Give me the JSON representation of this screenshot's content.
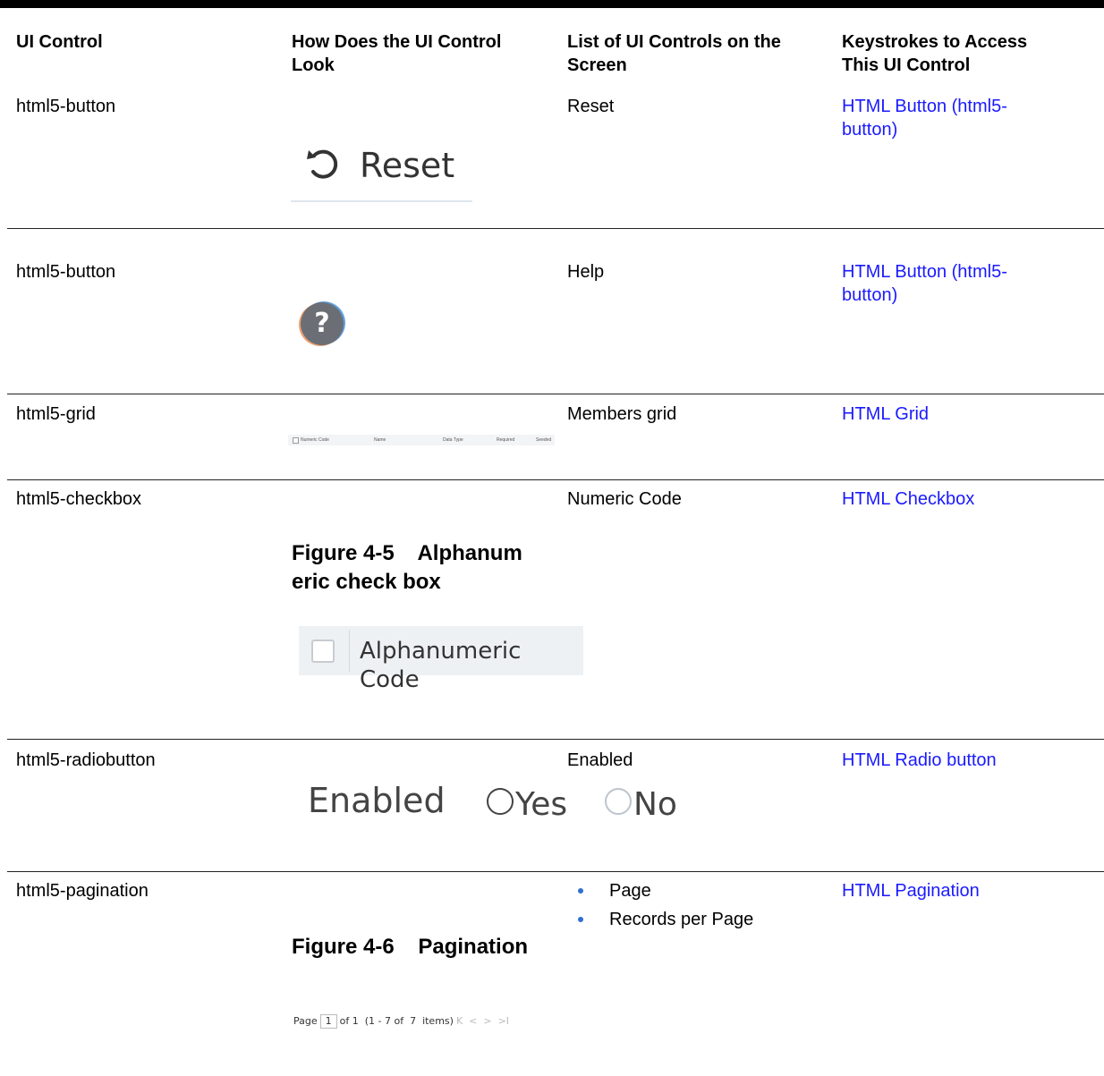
{
  "headers": {
    "col1": "UI Control",
    "col2_line1": "How Does the UI Control",
    "col2_line2": "Look",
    "col3_line1": "List of UI Controls on the",
    "col3_line2": "Screen",
    "col4_line1": "Keystrokes to Access",
    "col4_line2": "This UI Control"
  },
  "rows": {
    "reset": {
      "control": "html5-button",
      "look_label": "Reset",
      "look_icon": "reset-icon",
      "screen": "Reset",
      "link_line1": "HTML Button (html5-",
      "link_line2": "button)"
    },
    "help": {
      "control": "html5-button",
      "look_icon": "help-icon",
      "look_glyph": "?",
      "screen": "Help",
      "link_line1": "HTML Button (html5-",
      "link_line2": "button)"
    },
    "grid": {
      "control": "html5-grid",
      "grid_columns": [
        "Numeric Code",
        "Name",
        "Data Type",
        "Required",
        "Seeded"
      ],
      "screen": "Members grid",
      "link": "HTML Grid"
    },
    "checkbox": {
      "control": "html5-checkbox",
      "figure_line1": "Figure 4-5    Alphanum",
      "figure_line2": "eric check box",
      "look_label": "Alphanumeric Code",
      "screen": "Numeric Code",
      "link": "HTML Checkbox"
    },
    "radio": {
      "control": "html5-radiobutton",
      "look_label": "Enabled",
      "option_yes": "Yes",
      "option_no": "No",
      "screen": "Enabled",
      "link": "HTML Radio button"
    },
    "pagination": {
      "control": "html5-pagination",
      "figure": "Figure 4-6    Pagination",
      "bullets": [
        "Page",
        "Records per Page"
      ],
      "pag_page": "Page",
      "pag_num": "1",
      "pag_of": "of 1  (1 - 7 of  7  items)",
      "pag_nav": "K  <  >  >I",
      "link": "HTML Pagination"
    }
  }
}
